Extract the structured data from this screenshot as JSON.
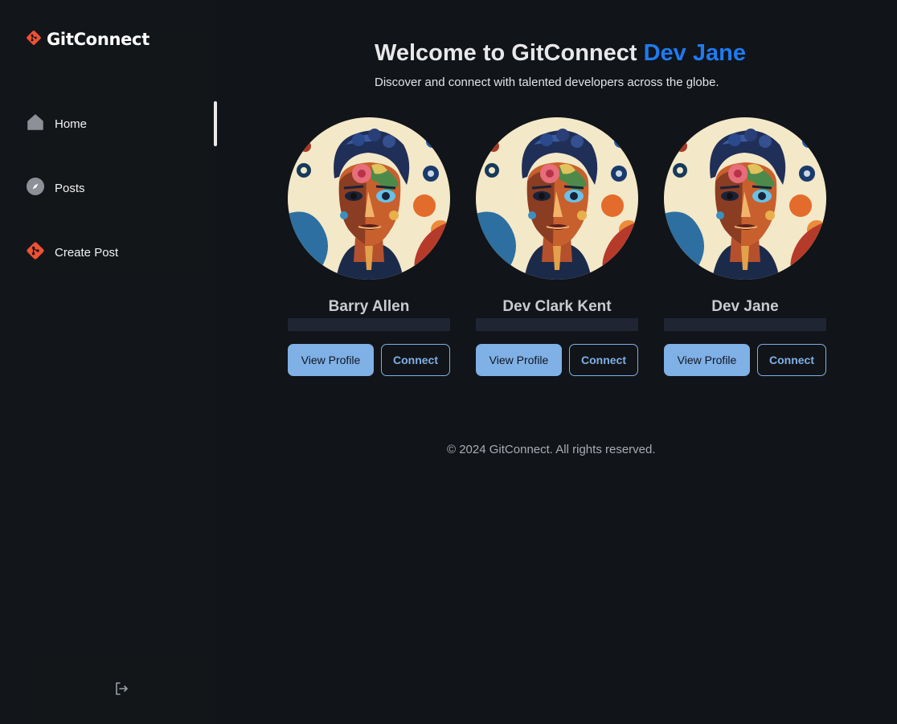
{
  "brand": {
    "name": "GitConnect",
    "logo_icon": "git-diamond-icon",
    "logo_color": "#f05033"
  },
  "nav": {
    "items": [
      {
        "label": "Home",
        "icon": "home-icon",
        "active": true
      },
      {
        "label": "Posts",
        "icon": "compass-icon",
        "active": false
      },
      {
        "label": "Create Post",
        "icon": "git-diamond-icon",
        "active": false
      }
    ]
  },
  "logout": {
    "icon": "logout-icon"
  },
  "main": {
    "title_prefix": "Welcome to GitConnect ",
    "title_user": "Dev Jane",
    "subtitle": "Discover and connect with talented developers across the globe.",
    "accent_color": "#1f7af0"
  },
  "cards": [
    {
      "name": "Barry Allen",
      "view_label": "View Profile",
      "connect_label": "Connect"
    },
    {
      "name": "Dev Clark Kent",
      "view_label": "View Profile",
      "connect_label": "Connect"
    },
    {
      "name": "Dev Jane",
      "view_label": "View Profile",
      "connect_label": "Connect"
    }
  ],
  "footer": {
    "text": "© 2024 GitConnect. All rights reserved."
  }
}
